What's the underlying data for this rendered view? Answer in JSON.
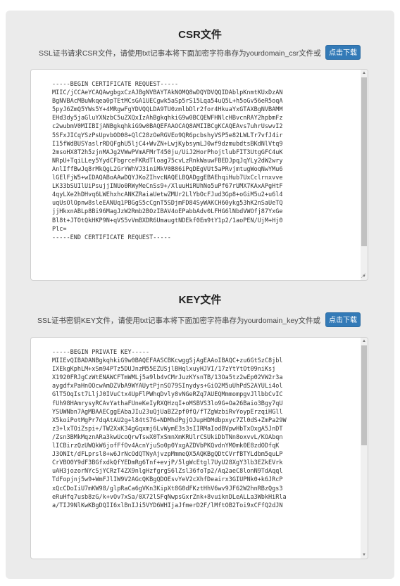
{
  "csr": {
    "title": "CSR文件",
    "info": "SSL证书请求CSR文件，请使用txt记事本将下面加密字符串存为yourdomain_csr文件或",
    "button": "点击下载",
    "content": "-----BEGIN CERTIFICATE REQUEST-----\nMIIC/jCCAeYCAQAwgbgxCzAJBgNVBAYTAkNOMQ8wDQYDVQQIDAblpKnmtKUxDzAN\nBgNVBAcMBuWkqea0pTEtMCsGA1UECgwk5aSp5rS15Lqa54uQ5L+h5oGv56eR5oqA\n5pyJ6ZmQ5YWs5Y+4MRgwFgYDVQQLDA9TU0zmlbDlr2for4HkuaYxGTAXBgNVBAMM\nEHd3dy5jaGluYXNzbC5uZXQxIzAhBgkqhkiG9w0BCQEWFHNlcHBvcnRAY2hpbmFz\nc2wubmV0MIIBIjANBgkqhkiG9w0BAQEFAAOCAQ8AMIIBCgKCAQEAvs7uhrUswvI2\n5SFxJICqYSzPsUpvbOD08+QlC28zOeRGVEo9QR6pcbshyVSP5e82LWLTr7vfJ4ir\nI15fWdBUSYaslrRDQFghU5ljC4+WvZN+LwjKybsymLJ0wf9dzmubdtsBKdNlVtq9\n2msoHX8T2h5zjnMAJg2VWwPVmAFMrT450ju/UiJ2HorPhojtlubFIT3UtgGFC4uK\nNRpU+TqiLLey5YydCFbgrceFKRdTloag75cvLzRnkWauwFBEDJpqJqYLy2dW2wry\nAnlIffBwJq8rMkQgL2GrYWhVJ3iniMkV0B86iPqDEgVUt5aPRvjmtugWoqNwYMu6\nlGElFjW5+wIDAQABoAAwDQYJKoZIhvcNAQELBQADggEBAEhqiHub7UxCclrnxvve\nLK33bSUIlUiPsujjINUo0RWyMeCnSs9+/XluuHiRUhNo5uPf67rUMX7KAxAPgHtF\n4qyLXe2hDHvq6LWEhxhcANKZRaiaUetwZMUr2LlYbOcFJud3Gp8+oGiM5u2+u6l4\nuqUsOlOpnw8sleEANUq1PBGgS5cCgnT5SDjmFD84SyWAKCH60ykg53hK2nSaUeTQ\njjHkxnABLp8Bi96MagJzW2Rmb2BOzIBAV4oEPabbAdv0LFHG6lNbdVWOfj87YxGe\nBl8t+JTOtQkHKP9N+qVS5vVmBXDR6UmaugtNDEkf0Em9tY1p2/1aoPEN/UjM+Hj0\nPlc=\n-----END CERTIFICATE REQUEST-----"
  },
  "key": {
    "title": "KEY文件",
    "info": "SSL证书密钥KEY文件，请使用txt记事本将下面加密字符串存为yourdomain_key文件或",
    "button": "点击下载",
    "content": "-----BEGIN PRIVATE KEY-----\nMIIEvQIBADANBgkqhkiG9w0BAQEFAASCBKcwggSjAgEAAoIBAQC+zu6GtSzC8jbl\nIXEkgKphLM+xSm94PTz5DUJnzM55EZUSjlBHqlxuyHJVI/17zYtYtOt09niKsj\nX1920FRJgCzWtENAWCFTmWMLj5a9lb4vCMrJuzKYsnTB/13Oa5tz2wEp02VW2r3a\naygdfxPaHnOOcwAmDZVbA9WYAUytPjnSO79SInydys+GiO2M5uUhPdS2AYULi4ol\nGlT5OqIst7LljJ0IVuCtx4UpFlPWhqDvly8vNGeRZq7AUEQMmmompgvJllbbCvIC\nfUh98HAmrysyRCAvYathaFUneKeIyRXQHzqI+oMSBVS3lo9G+Oa26Baio3Bgy7qU\nYSUWNbn7AgMBAAECggEAbaJIu23uQjUaBZ2pf0fQ/fTZgWzbiRvYoypErzqiHGll\nX5koiPotMgPr7dqAtAU2g+l84tS76+NDMhdPgjOJupHDMdbpxyc7Zl0dS+ZmPa29W\nz3+lxTOiZspi+/TW2XxK34gGqxmj6LvWymE3s3sIIRMaIodBVpwHbTxOxgA5JnDT\n/Zsn3BMkMqznARa3kwUcoQrwTswX0TxSmnXmKRUlrCSUkiDbTNn8oxvvL/KOAbqn\nlICBirzQzUWQkW6jofFfOv4AcnYjuSo0p0YxgAZDVbPKQvdnYMOmk0E8zdODfqK\nJ3ONIt/dFLprsl8+w6JrNcOdQTNyAjvzpMmmeQX5AQKBgQDtCVrfBTYLdbm5quLP\nCrVBO0Y9dF3BGfxdkQfYEDmRg6Tnf+evjP/5lgWcEtgl7UyU28XgY3lb3EZkEVrk\nuAH3jozorNYcSjYCRzT4ZX9nlgHzfgrgS6lZsl36foTp2/Aq2aeC8lonN9TdAqql\nTdFopjnj5w9+WmFJlIW9V2AGcQKBgQDOEsvYeV2cXhfDeairx3GIUPNk0+k6JRcP\nxQcCDoIiU7mKW98/glpRaCa6gVKn3KipXt8G0dFKztHhV6wv9JF62W2hnRBzQgs3\neRuHfq7usb8zG/k+vOv7xSa/0X72lSFqNwpsGxrZnk+8vuiknDLeALLa3WbkHiRla\na/TIJ9NlKwKBgDQII6xlBnIJi5VYD6WHIjaJfmerD2F/lMftOB2Toi9xCFfQ2dJN"
  }
}
